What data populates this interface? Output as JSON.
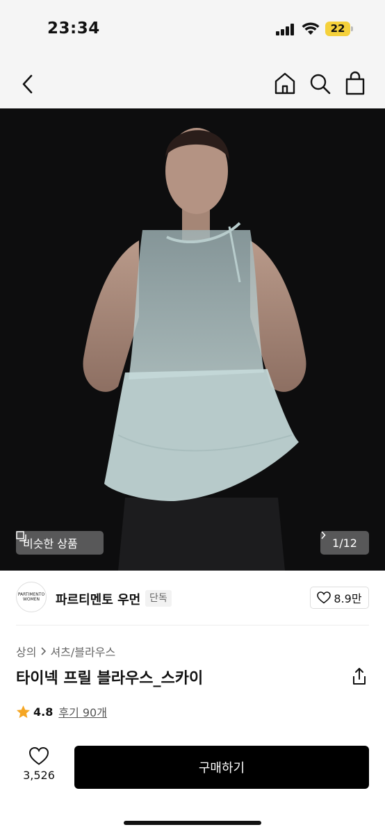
{
  "status_bar": {
    "time": "23:34",
    "battery_level": "22",
    "icons": [
      "signal-icon",
      "wifi-icon",
      "battery-icon"
    ]
  },
  "nav": {
    "icons": [
      "back-icon",
      "home-icon",
      "search-icon",
      "bag-icon"
    ]
  },
  "hero": {
    "similar_label": "비슷한 상품",
    "page_counter": "1/12"
  },
  "brand": {
    "logo_line1": "PARTIMENTO",
    "logo_line2": "WOMEN",
    "name": "파르티멘토 우먼",
    "badge": "단독",
    "like_count": "8.9만"
  },
  "product": {
    "breadcrumb": [
      "상의",
      "셔츠/블라우스"
    ],
    "title": "타이넥 프릴 블라우스_스카이",
    "rating": "4.8",
    "reviews": "후기 90개"
  },
  "bottom_bar": {
    "like_count": "3,526",
    "buy_label": "구매하기"
  },
  "colors": {
    "accent_star": "#f5a623",
    "buy_button": "#000000",
    "battery": "#f5d13b"
  }
}
